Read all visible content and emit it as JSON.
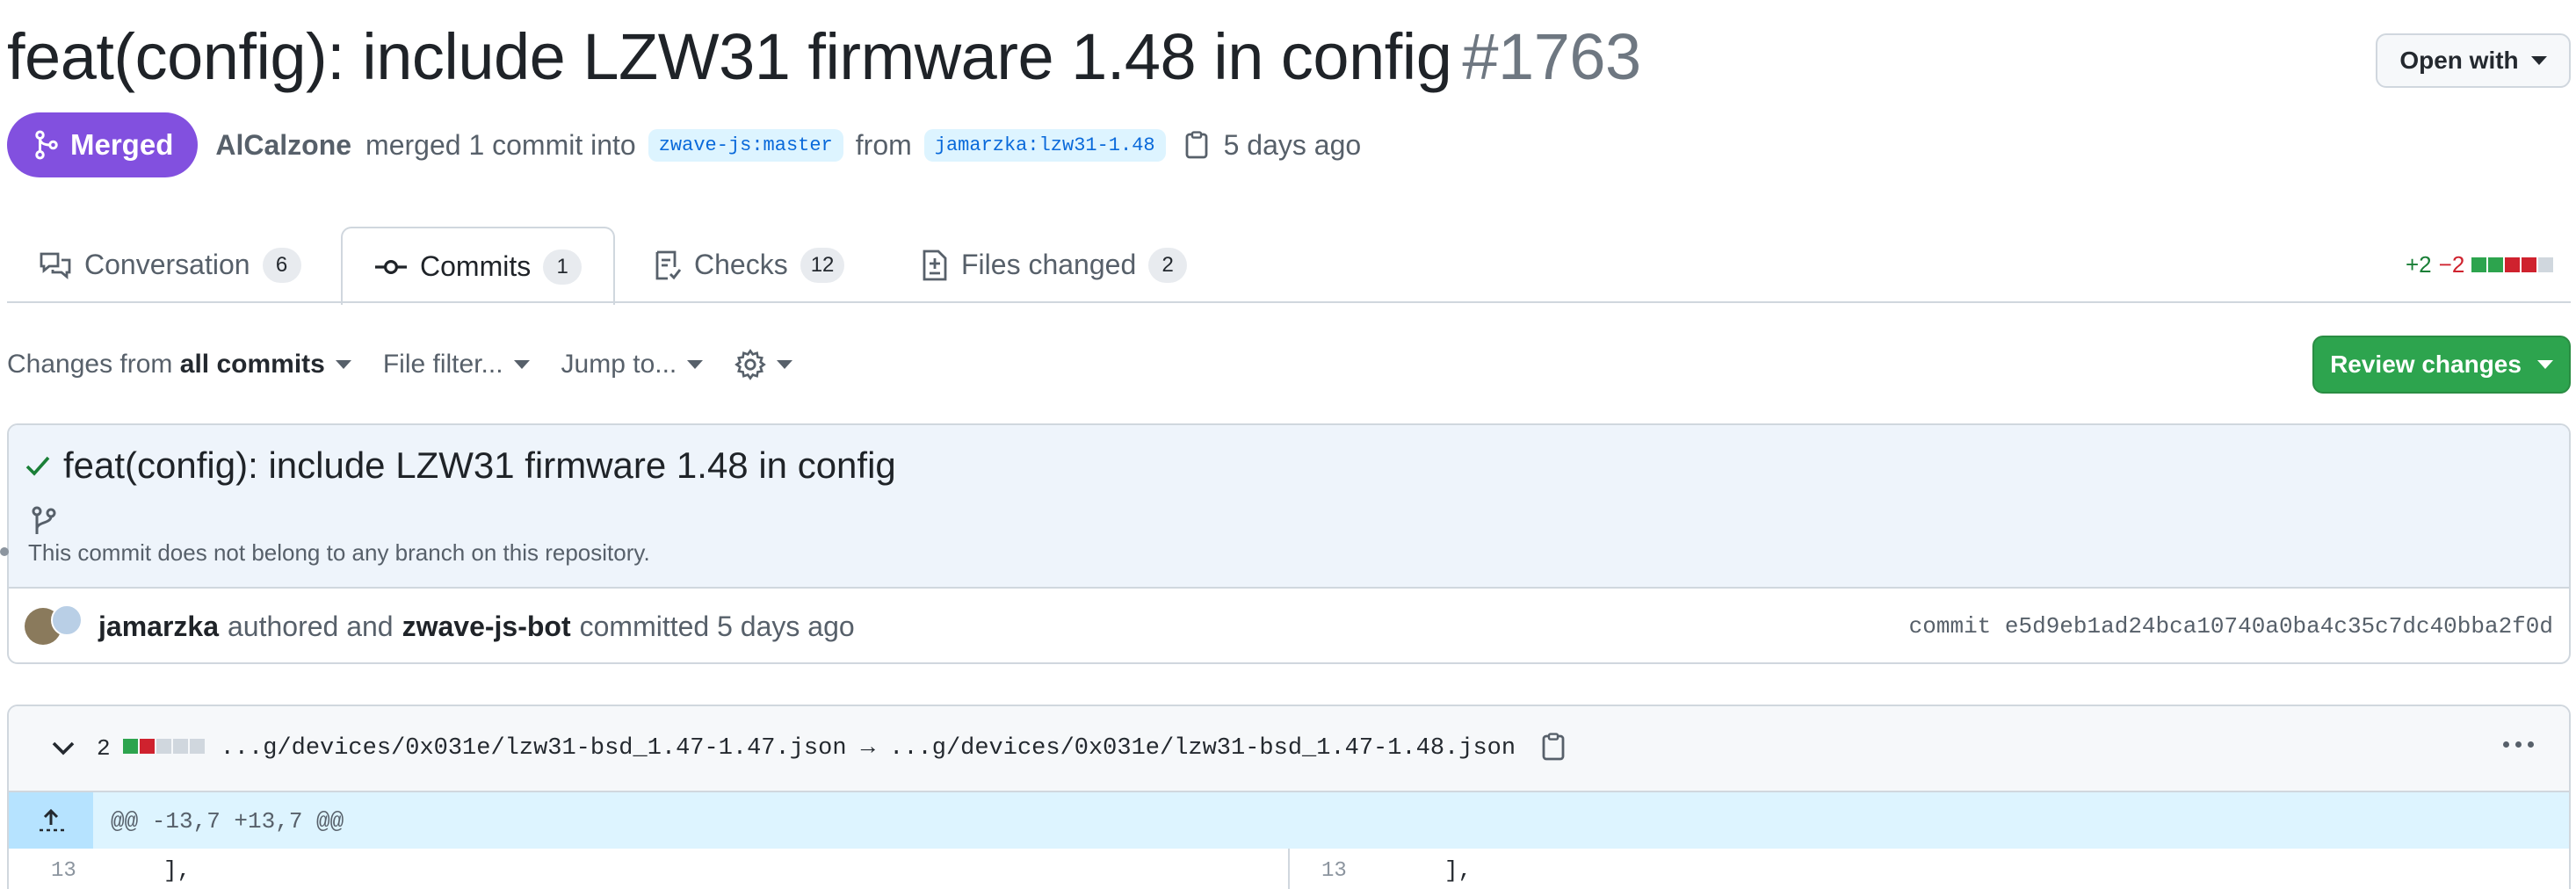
{
  "header": {
    "title": "feat(config): include LZW31 firmware 1.48 in config",
    "pr_number": "#1763",
    "open_with_label": "Open with"
  },
  "meta": {
    "status": "Merged",
    "author": "AlCalzone",
    "merged_text": "merged 1 commit into",
    "base_branch": "zwave-js:master",
    "from_text": "from",
    "head_branch": "jamarzka:lzw31-1.48",
    "time": "5 days ago",
    "status_color": "#8250df"
  },
  "tabs": [
    {
      "label": "Conversation",
      "count": "6",
      "icon": "comment-discussion-icon"
    },
    {
      "label": "Commits",
      "count": "1",
      "icon": "git-commit-icon"
    },
    {
      "label": "Checks",
      "count": "12",
      "icon": "checklist-icon"
    },
    {
      "label": "Files changed",
      "count": "2",
      "icon": "file-diff-icon"
    }
  ],
  "diffstat": {
    "additions": "+2",
    "deletions": "−2"
  },
  "toolbar": {
    "changes_prefix": "Changes from",
    "changes_value": "all commits",
    "file_filter": "File filter...",
    "jump_to": "Jump to...",
    "review_button": "Review changes"
  },
  "commit": {
    "title": "feat(config): include LZW31 firmware 1.48 in config",
    "note": "This commit does not belong to any branch on this repository.",
    "author": "jamarzka",
    "authored_text": "authored and",
    "committer": "zwave-js-bot",
    "committed_text": "committed 5 days ago",
    "sha_label": "commit",
    "sha": "e5d9eb1ad24bca10740a0ba4c35c7dc40bba2f0d"
  },
  "file": {
    "changes": "2",
    "old_path": "...g/devices/0x031e/lzw31-bsd_1.47-1.47.json",
    "arrow": "→",
    "new_path": "...g/devices/0x031e/lzw31-bsd_1.47-1.48.json",
    "hunk": "@@ -13,7 +13,7 @@",
    "left_line_no": "13",
    "left_code": "],",
    "right_line_no": "13",
    "right_code": "],"
  },
  "colors": {
    "merged": "#8250df",
    "review_button": "#2da44e",
    "addition": "#1a7f37",
    "deletion": "#cf222e",
    "link": "#0969da"
  }
}
